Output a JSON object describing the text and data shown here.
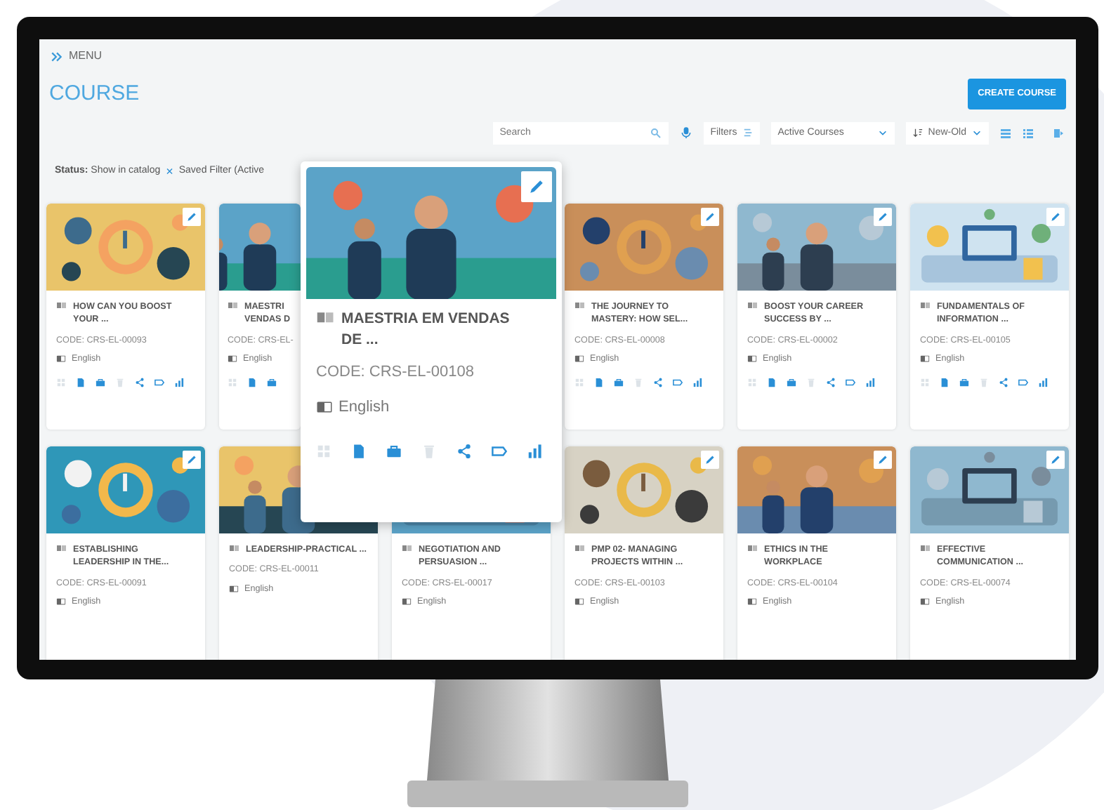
{
  "menu": {
    "label": "MENU"
  },
  "page_title": "COURSE",
  "create_button": "CREATE COURSE",
  "toolbar": {
    "search": {
      "placeholder": "Search"
    },
    "filters": "Filters",
    "status_select": "Active Courses",
    "sort": "New-Old"
  },
  "filter_bar": {
    "status": "**Status:** Show in catalog",
    "remove": "×",
    "saved_filter": "Saved Filter (Active"
  },
  "rows": [
    [
      {
        "kind": "card",
        "title": "HOW CAN YOU BOOST YOUR ...",
        "code": "CODE: CRS-EL-00093",
        "language": "English",
        "edit_icon": true,
        "actions": [
          {
            "kind": "grid",
            "disabled": true
          },
          {
            "kind": "document",
            "disabled": false
          },
          {
            "kind": "briefcase",
            "disabled": false
          },
          {
            "kind": "trash",
            "disabled": true
          },
          {
            "kind": "share",
            "disabled": false
          },
          {
            "kind": "ticket",
            "disabled": false
          },
          {
            "kind": "chart",
            "disabled": false
          }
        ]
      },
      {
        "kind": "card",
        "partial": true,
        "title": "MAESTRI VENDAS D",
        "code": "CODE: CRS-EL-",
        "language": "English",
        "edit_icon": false,
        "actions": [
          {
            "kind": "grid",
            "disabled": true
          },
          {
            "kind": "document",
            "disabled": false
          },
          {
            "kind": "briefcase",
            "disabled": false
          }
        ]
      },
      {
        "kind": "covered"
      },
      {
        "kind": "card",
        "title": "THE JOURNEY TO MASTERY: HOW SEL...",
        "code": "CODE: CRS-EL-00008",
        "language": "English",
        "edit_icon": true,
        "actions": [
          {
            "kind": "grid",
            "disabled": true
          },
          {
            "kind": "document",
            "disabled": false
          },
          {
            "kind": "briefcase",
            "disabled": false
          },
          {
            "kind": "trash",
            "disabled": true
          },
          {
            "kind": "share",
            "disabled": false
          },
          {
            "kind": "ticket",
            "disabled": false
          },
          {
            "kind": "chart",
            "disabled": false
          }
        ]
      },
      {
        "kind": "card",
        "title": "BOOST YOUR CAREER SUCCESS BY ...",
        "code": "CODE: CRS-EL-00002",
        "language": "English",
        "edit_icon": true,
        "actions": [
          {
            "kind": "grid",
            "disabled": true
          },
          {
            "kind": "document",
            "disabled": false
          },
          {
            "kind": "briefcase",
            "disabled": false
          },
          {
            "kind": "trash",
            "disabled": true
          },
          {
            "kind": "share",
            "disabled": false
          },
          {
            "kind": "ticket",
            "disabled": false
          },
          {
            "kind": "chart",
            "disabled": false
          }
        ]
      },
      {
        "kind": "card",
        "title": "FUNDAMENTALS OF INFORMATION ...",
        "code": "CODE: CRS-EL-00105",
        "language": "English",
        "edit_icon": true,
        "actions": [
          {
            "kind": "grid",
            "disabled": true
          },
          {
            "kind": "document",
            "disabled": false
          },
          {
            "kind": "briefcase",
            "disabled": false
          },
          {
            "kind": "trash",
            "disabled": true
          },
          {
            "kind": "share",
            "disabled": false
          },
          {
            "kind": "ticket",
            "disabled": false
          },
          {
            "kind": "chart",
            "disabled": false
          }
        ]
      }
    ],
    [
      {
        "kind": "card",
        "title": "ESTABLISHING LEADERSHIP IN THE...",
        "code": "CODE: CRS-EL-00091",
        "language": "English",
        "edit_icon": true
      },
      {
        "kind": "card",
        "title": "LEADERSHIP-PRACTICAL ...",
        "code": "CODE: CRS-EL-00011",
        "language": "English",
        "edit_icon": false
      },
      {
        "kind": "card",
        "title": "NEGOTIATION AND PERSUASION ...",
        "code": "CODE: CRS-EL-00017",
        "language": "English",
        "edit_icon": false
      },
      {
        "kind": "card",
        "title": "PMP 02- MANAGING PROJECTS WITHIN ...",
        "code": "CODE: CRS-EL-00103",
        "language": "English",
        "edit_icon": true
      },
      {
        "kind": "card",
        "title": "ETHICS IN THE WORKPLACE",
        "code": "CODE: CRS-EL-00104",
        "language": "English",
        "edit_icon": true
      },
      {
        "kind": "card",
        "title": "EFFECTIVE COMMUNICATION ...",
        "code": "CODE: CRS-EL-00074",
        "language": "English",
        "edit_icon": true
      }
    ]
  ],
  "popup": {
    "title": "MAESTRIA EM VENDAS DE ...",
    "code": "CODE: CRS-EL-00108",
    "language": "English",
    "edit_icon": true,
    "actions": [
      {
        "kind": "grid",
        "disabled": true
      },
      {
        "kind": "document",
        "disabled": false
      },
      {
        "kind": "briefcase",
        "disabled": false
      },
      {
        "kind": "trash",
        "disabled": true
      },
      {
        "kind": "share",
        "disabled": false
      },
      {
        "kind": "ticket",
        "disabled": false
      },
      {
        "kind": "chart",
        "disabled": false
      }
    ]
  }
}
